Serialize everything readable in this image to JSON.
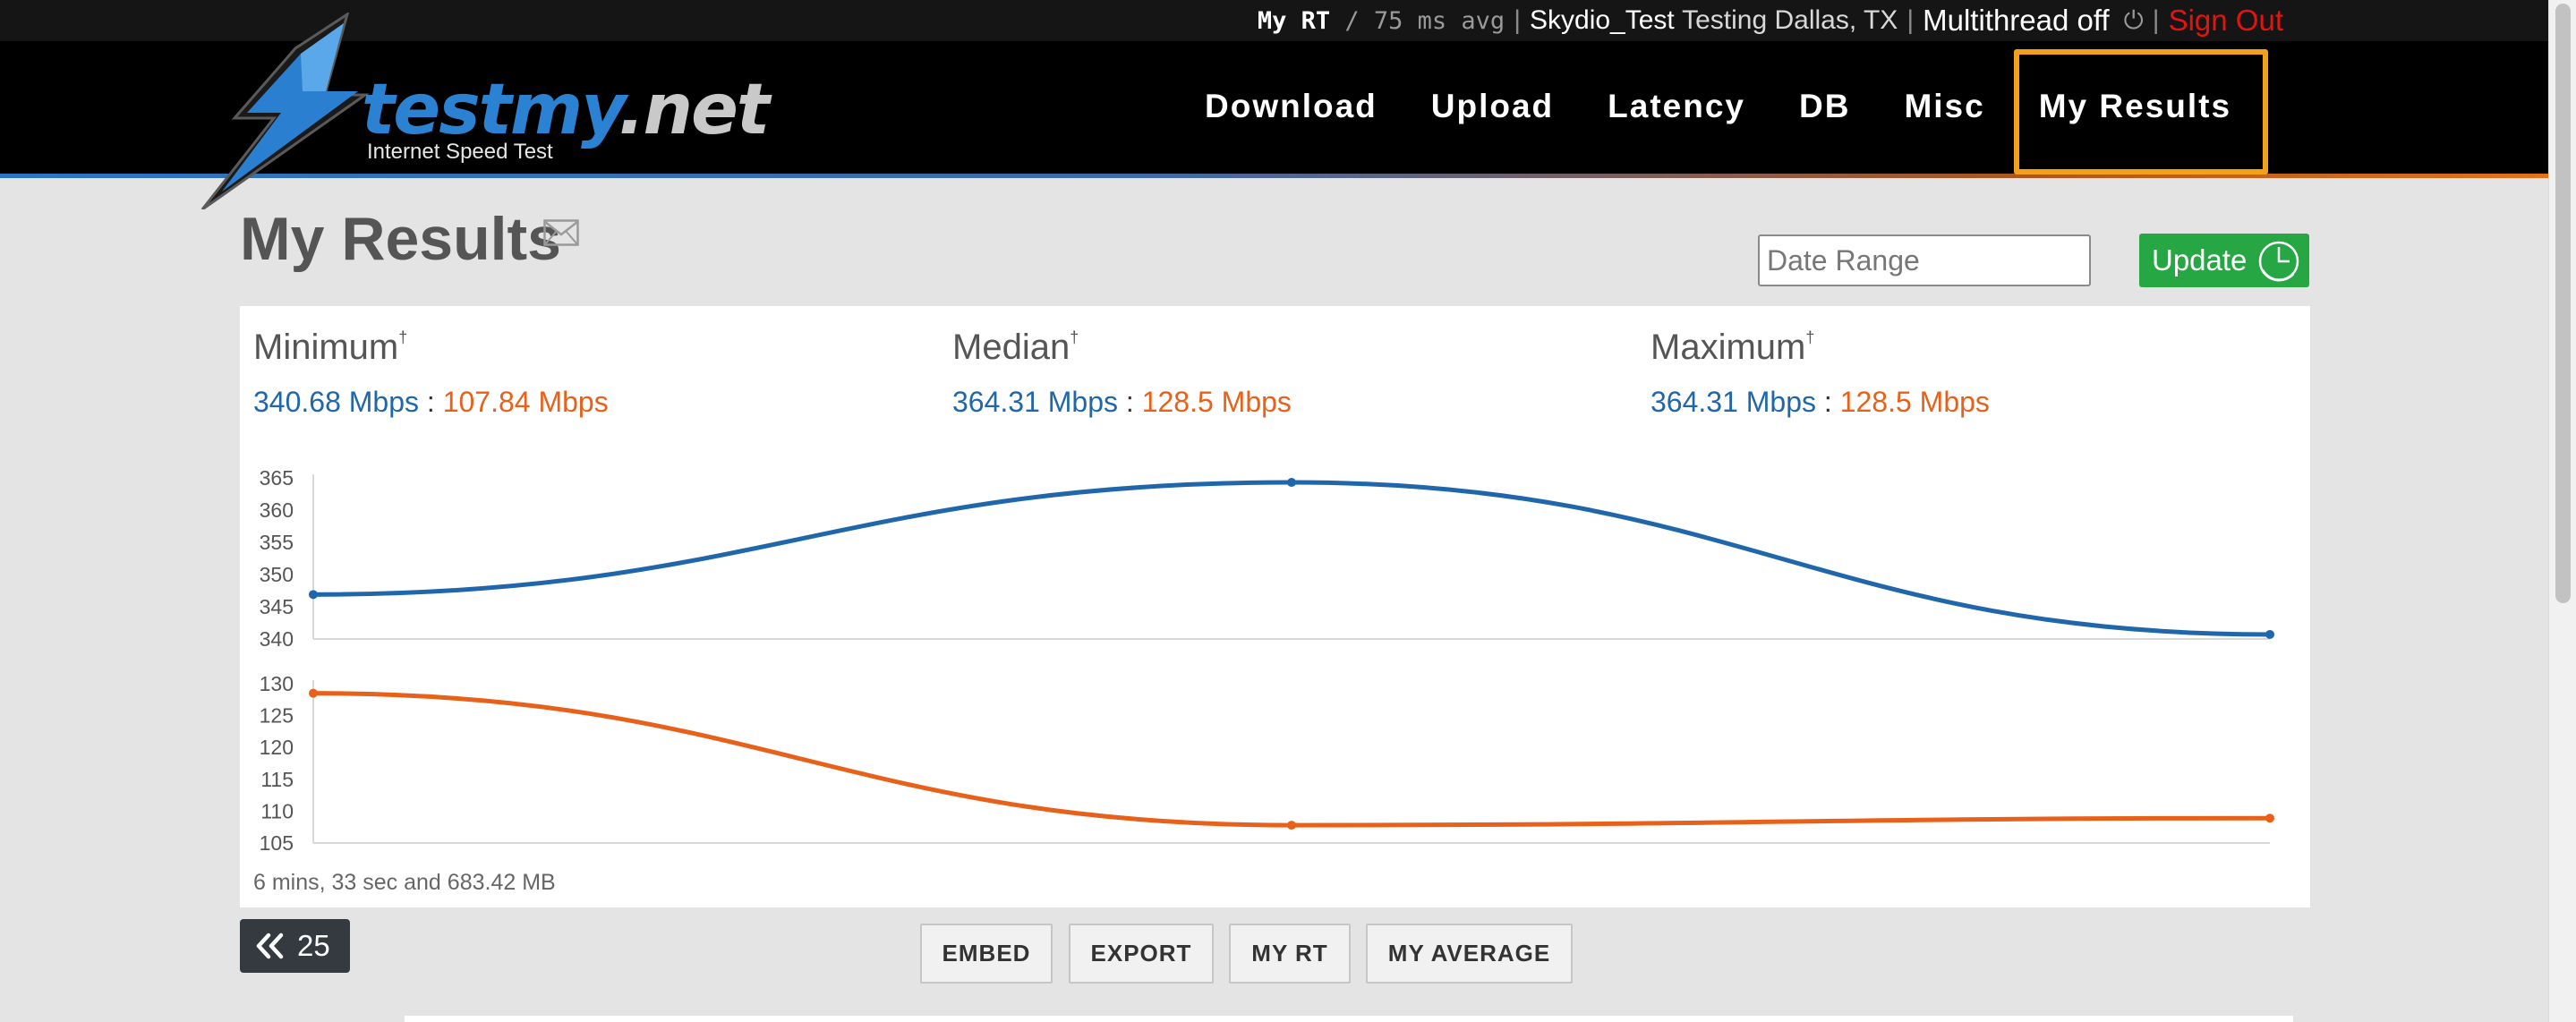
{
  "topbar": {
    "my_rt": "My RT",
    "avg_sep": "/",
    "avg": "75 ms avg",
    "user": "Skydio_Test",
    "location": "Testing Dallas, TX",
    "multithread": "Multithread off",
    "signout": "Sign Out"
  },
  "logo": {
    "brand_main": "testmy",
    "brand_tld": ".net",
    "tagline": "Internet Speed Test"
  },
  "nav": {
    "items": [
      "Download",
      "Upload",
      "Latency",
      "DB",
      "Misc",
      "My Results"
    ],
    "active": "My Results"
  },
  "page": {
    "title": "My Results",
    "date_range_placeholder": "Date Range",
    "update_label": "Update"
  },
  "stats": {
    "minimum": {
      "label": "Minimum",
      "marker": "†",
      "download": "340.68 Mbps",
      "upload": "107.84 Mbps"
    },
    "median": {
      "label": "Median",
      "marker": "†",
      "download": "364.31 Mbps",
      "upload": "128.5 Mbps"
    },
    "maximum": {
      "label": "Maximum",
      "marker": "†",
      "download": "364.31 Mbps",
      "upload": "128.5 Mbps"
    },
    "separator": ":"
  },
  "colors": {
    "download": "#1f67aa",
    "upload": "#e8611a",
    "accent_box": "#f5a01a",
    "update_green": "#27a744",
    "signout_red": "#e3140f"
  },
  "chart_data": [
    {
      "type": "line",
      "series": [
        {
          "values": [
            346.9,
            364.3,
            340.7
          ]
        }
      ],
      "x": [
        1,
        2,
        3
      ],
      "yticks": [
        "365",
        "360",
        "355",
        "350",
        "345",
        "340"
      ],
      "ylim": [
        340,
        365
      ],
      "grid": false
    },
    {
      "type": "line",
      "series": [
        {
          "values": [
            128.5,
            107.8,
            108.9
          ]
        }
      ],
      "x": [
        1,
        2,
        3
      ],
      "yticks": [
        "130",
        "125",
        "120",
        "115",
        "110",
        "105"
      ],
      "ylim": [
        105,
        130
      ],
      "grid": false
    }
  ],
  "summary": {
    "duration": "6 mins, 33 sec and 683.42 MB"
  },
  "controls": {
    "prev_count": "25",
    "buttons": [
      "EMBED",
      "EXPORT",
      "MY RT",
      "MY AVERAGE"
    ]
  }
}
